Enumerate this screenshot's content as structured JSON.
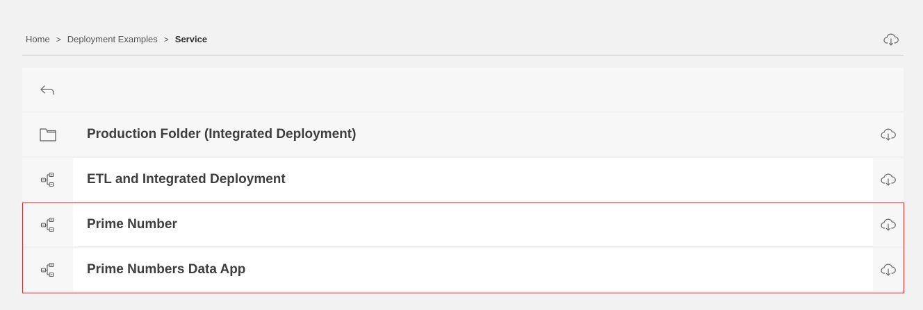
{
  "breadcrumb": {
    "items": [
      {
        "label": "Home"
      },
      {
        "label": "Deployment Examples"
      },
      {
        "label": "Service"
      }
    ],
    "separator": ">"
  },
  "list": {
    "rows": [
      {
        "label": "Production Folder (Integrated Deployment)",
        "type": "folder",
        "icon": "folder-icon"
      },
      {
        "label": "ETL and Integrated Deployment",
        "type": "workflow",
        "icon": "workflow-icon"
      },
      {
        "label": "Prime Number",
        "type": "workflow",
        "icon": "workflow-icon"
      },
      {
        "label": "Prime Numbers Data App",
        "type": "workflow",
        "icon": "workflow-icon"
      }
    ]
  },
  "colors": {
    "highlight": "#e0262b",
    "background": "#f2f2f2",
    "row": "#ffffff"
  }
}
